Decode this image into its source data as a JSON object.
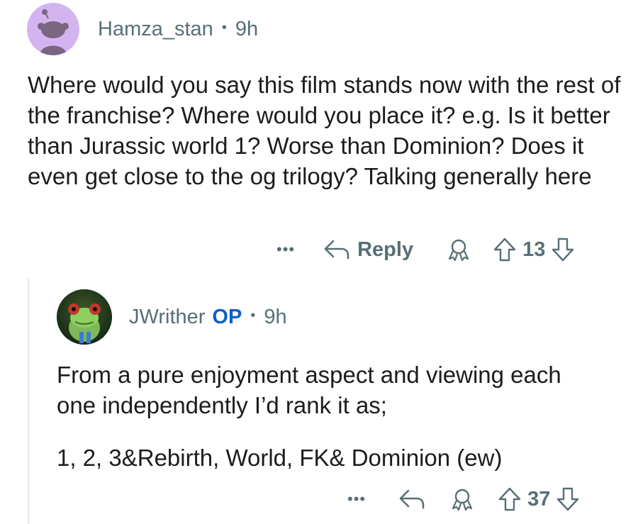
{
  "comments": [
    {
      "username": "Hamza_stan",
      "time": "9h",
      "avatar": "reddit-default-avatar-icon",
      "body": "Where would you say this film stands now with the rest of the franchise? Where would you place it? e.g. Is it better than Jurassic world 1? Worse than Dominion? Does it even get close to the og trilogy? Talking generally here",
      "actions": {
        "more": "•••",
        "reply_label": "Reply",
        "score": "13"
      }
    },
    {
      "username": "JWrither",
      "op_badge": "OP",
      "time": "9h",
      "avatar": "frog-avatar-icon",
      "body_line1": "From a pure enjoyment aspect and viewing each one independently I’d rank it as;",
      "body_line2": "1, 2, 3&Rebirth, World, FK& Dominion (ew)",
      "actions": {
        "more": "•••",
        "score": "37"
      }
    }
  ],
  "colors": {
    "meta": "#576f76",
    "op": "#0b5fcf",
    "avatar_bg": "#d4b4f0"
  }
}
